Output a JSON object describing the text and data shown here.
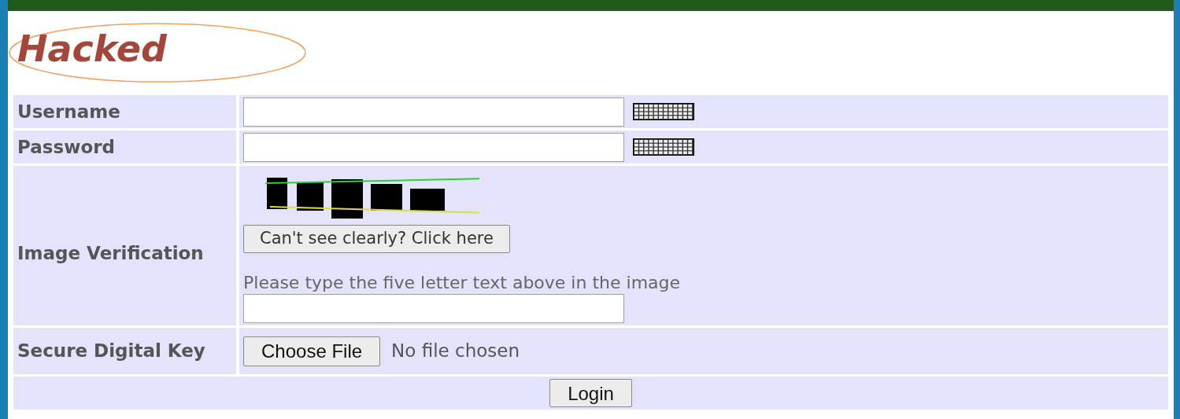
{
  "annotation": "Hacked",
  "form": {
    "rows": [
      {
        "kind": "text",
        "label": "Username",
        "virtual_keyboard": true
      },
      {
        "kind": "text",
        "label": "Password",
        "virtual_keyboard": true
      },
      {
        "kind": "captcha",
        "label": "Image Verification",
        "refresh_button": "Can't see clearly? Click here",
        "instruction": "Please type the five letter text above in the image"
      },
      {
        "kind": "file",
        "label": "Secure Digital Key",
        "button": "Choose File",
        "status": "No file chosen"
      }
    ],
    "submit": "Login"
  }
}
